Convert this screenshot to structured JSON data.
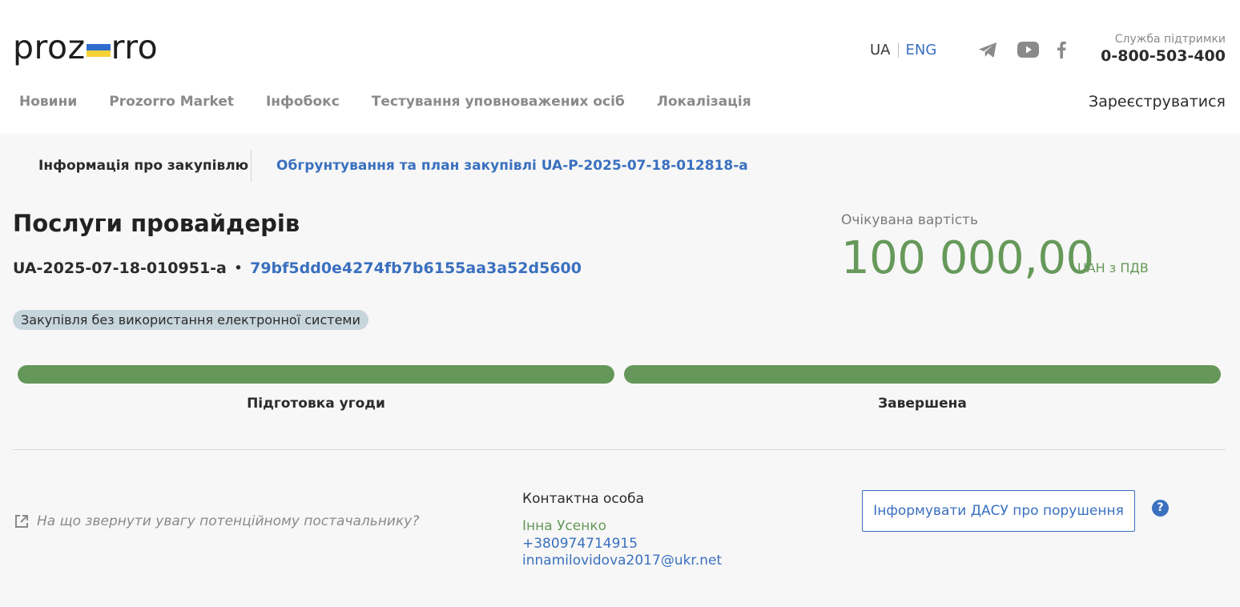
{
  "header": {
    "logo_left": "proz",
    "logo_right": "rro",
    "lang_ua": "UA",
    "lang_eng": "ENG",
    "support_label": "Служба підтримки",
    "support_phone": "0-800-503-400",
    "register": "Зареєструватися",
    "nav": [
      "Новини",
      "Prozorro Market",
      "Інфобокс",
      "Тестування уповноважених осіб",
      "Локалізація"
    ],
    "social_icons": [
      "telegram-icon",
      "youtube-icon",
      "facebook-icon"
    ]
  },
  "tabs": {
    "info": "Інформація про закупівлю",
    "plan": "Обгрунтування та план закупівлі UA-P-2025-07-18-012818-a"
  },
  "tender": {
    "title": "Послуги провайдерів",
    "id": "UA-2025-07-18-010951-a",
    "separator": "•",
    "hash": "79bf5dd0e4274fb7b6155aa3a52d5600",
    "badge": "Закупівля без використання електронної системи",
    "expected_label": "Очікувана вартість",
    "amount": "100 000,00",
    "currency": "UAH з ПДВ"
  },
  "stages": [
    {
      "label": "Підготовка угоди",
      "progress": 1
    },
    {
      "label": "Завершена",
      "progress": 1
    }
  ],
  "footer": {
    "hint": "На що звернути увагу потенційному постачальнику?",
    "contact_label": "Контактна особа",
    "contact_name": "Інна Усенко",
    "contact_phone": "+380974714915",
    "contact_email": "innamilovidova2017@ukr.net",
    "dasu_button": "Інформувати ДАСУ про порушення",
    "help": "?"
  },
  "colors": {
    "accent_blue": "#3a70bf",
    "accent_green": "#66995a",
    "badge_bg": "#c7d6dd"
  }
}
